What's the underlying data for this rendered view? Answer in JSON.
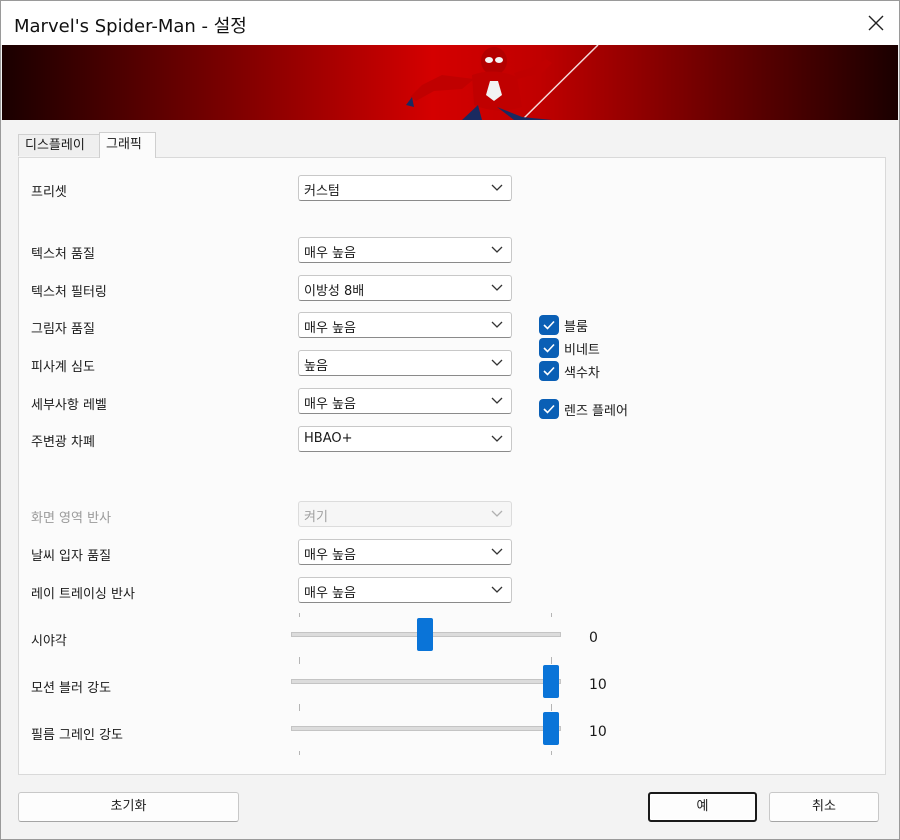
{
  "window": {
    "title": "Marvel's Spider-Man - 설정"
  },
  "tabs": [
    {
      "label": "디스플레이",
      "active": false
    },
    {
      "label": "그래픽",
      "active": true
    }
  ],
  "settings": {
    "preset": {
      "label": "프리셋",
      "value": "커스텀"
    },
    "texture_quality": {
      "label": "텍스처 품질",
      "value": "매우 높음"
    },
    "texture_filtering": {
      "label": "텍스처 필터링",
      "value": "이방성 8배"
    },
    "shadow_quality": {
      "label": "그림자 품질",
      "value": "매우 높음"
    },
    "depth_of_field": {
      "label": "피사계 심도",
      "value": "높음"
    },
    "level_of_detail": {
      "label": "세부사항 레벨",
      "value": "매우 높음"
    },
    "ambient_occlusion": {
      "label": "주변광 차폐",
      "value": "HBAO+"
    },
    "screen_space_reflections": {
      "label": "화면 영역 반사",
      "value": "켜기",
      "disabled": true
    },
    "weather_particle_quality": {
      "label": "날씨 입자 품질",
      "value": "매우 높음"
    },
    "ray_traced_reflections": {
      "label": "레이 트레이싱 반사",
      "value": "매우 높음"
    }
  },
  "checkboxes": [
    {
      "label": "블룸",
      "checked": true
    },
    {
      "label": "비네트",
      "checked": true
    },
    {
      "label": "색수차",
      "checked": true
    },
    {
      "label": "렌즈 플레어",
      "checked": true
    }
  ],
  "sliders": {
    "fov": {
      "label": "시야각",
      "value": "0",
      "fraction": 0.5
    },
    "motion_blur": {
      "label": "모션 블러 강도",
      "value": "10",
      "fraction": 1.0
    },
    "film_grain": {
      "label": "필름 그레인 강도",
      "value": "10",
      "fraction": 1.0
    }
  },
  "buttons": {
    "reset": "초기화",
    "ok": "예",
    "cancel": "취소"
  },
  "colors": {
    "accent": "#0a74d8",
    "checkbox": "#0a5fb5",
    "banner_red": "#d40000"
  }
}
